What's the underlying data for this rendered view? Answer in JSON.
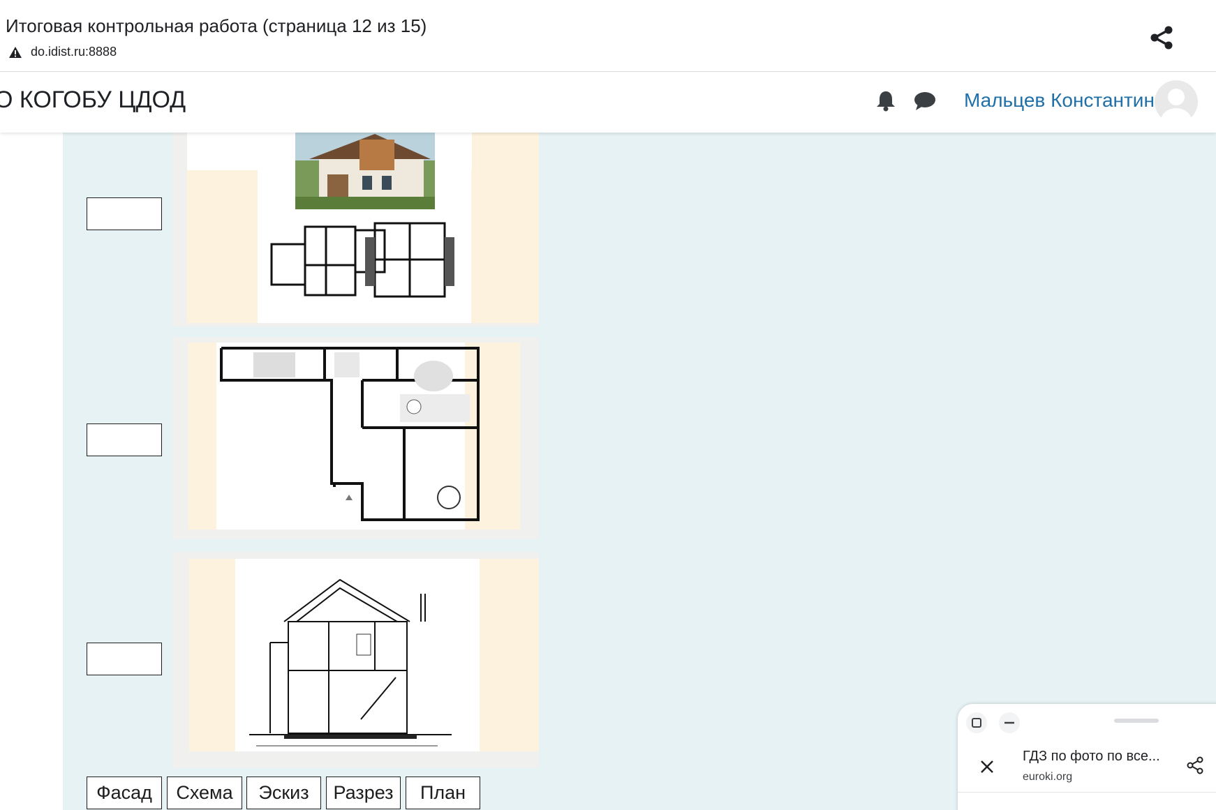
{
  "browser": {
    "page_title": "Итоговая контрольная работа (страница 12 из 15)",
    "url": "do.idist.ru:8888",
    "icons": [
      "warning-icon",
      "share-icon"
    ]
  },
  "header": {
    "site_name": "О КОГОБУ ЦДОД",
    "user_name": "Мальцев Константин",
    "icons": [
      "bell-icon",
      "chat-icon",
      "avatar"
    ]
  },
  "question": {
    "drop_zones": [
      "",
      "",
      ""
    ],
    "images": [
      "house-photo-with-floor-plans",
      "apartment-floor-plan",
      "house-section-drawing"
    ],
    "choices": [
      "Фасад",
      "Схема",
      "Эскиз",
      "Разрез",
      "План"
    ]
  },
  "mini_window": {
    "title": "ГДЗ по фото по все...",
    "url": "euroki.org",
    "icons": [
      "maximize-icon",
      "minimize-icon",
      "close-icon",
      "share-icon"
    ]
  }
}
